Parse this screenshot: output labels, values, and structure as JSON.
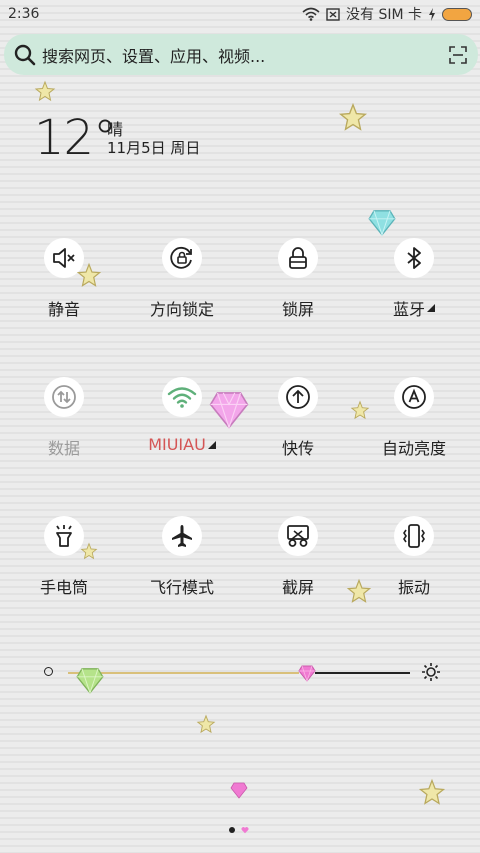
{
  "status": {
    "time": "2:36",
    "sim": "没有 SIM 卡"
  },
  "search": {
    "placeholder": "搜索网页、设置、应用、视频..."
  },
  "weather": {
    "temperature": "12°",
    "condition": "晴",
    "date": "11月5日 周日"
  },
  "toggles": [
    {
      "label": "静音",
      "icon": "mute-icon"
    },
    {
      "label": "方向锁定",
      "icon": "rotation-lock-icon"
    },
    {
      "label": "锁屏",
      "icon": "lock-icon"
    },
    {
      "label": "蓝牙",
      "icon": "bluetooth-icon"
    },
    {
      "label": "数据",
      "icon": "data-icon"
    },
    {
      "label": "MIUIAU",
      "icon": "wifi-icon"
    },
    {
      "label": "快传",
      "icon": "quick-transfer-icon"
    },
    {
      "label": "自动亮度",
      "icon": "auto-brightness-icon"
    },
    {
      "label": "手电筒",
      "icon": "flashlight-icon"
    },
    {
      "label": "飞行模式",
      "icon": "airplane-icon"
    },
    {
      "label": "截屏",
      "icon": "screenshot-icon"
    },
    {
      "label": "振动",
      "icon": "vibrate-icon"
    }
  ],
  "brightness": {
    "level": 0.7
  },
  "pager": {
    "current": 1,
    "total": 2
  },
  "colors": {
    "search_bg": "#cfe9dc",
    "wifi_green": "#5fb07a",
    "wifi_label": "#d45555",
    "battery": "#f2a541"
  }
}
